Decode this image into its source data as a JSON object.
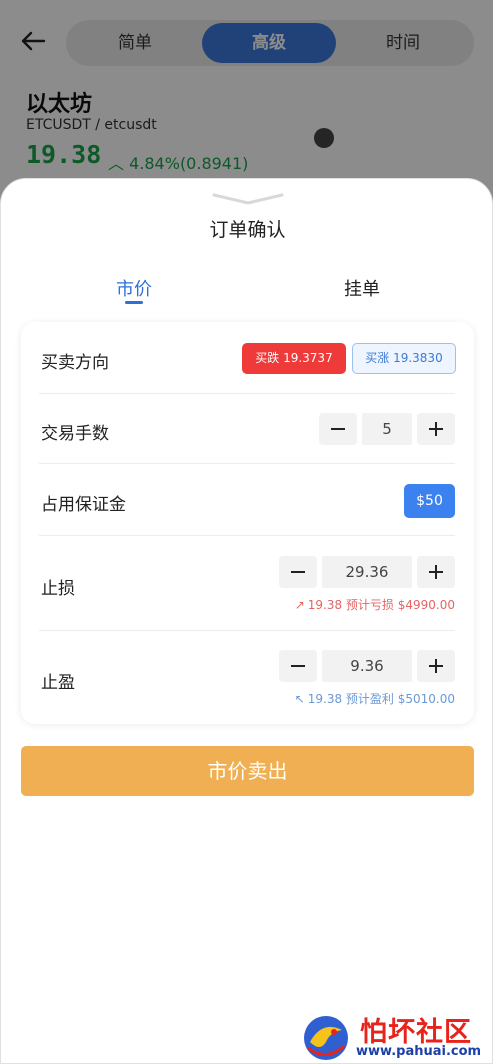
{
  "header": {
    "mode_tabs": [
      "简单",
      "高级",
      "时间"
    ],
    "active_mode": "高级"
  },
  "coin": {
    "name": "以太坊",
    "pair": "ETCUSDT / etcusdt",
    "price": "19.38",
    "change": "4.84%(0.8941)"
  },
  "sheet": {
    "title": "订单确认",
    "tabs": [
      "市价",
      "挂单"
    ],
    "active_tab": "市价",
    "direction": {
      "label": "买卖方向",
      "sell": "买跌 19.3737",
      "buy": "买涨 19.3830"
    },
    "lots": {
      "label": "交易手数",
      "value": "5"
    },
    "margin": {
      "label": "占用保证金",
      "value": "$50"
    },
    "stop_loss": {
      "label": "止损",
      "value": "29.36",
      "hint": "19.38 预计亏损 $4990.00"
    },
    "take_profit": {
      "label": "止盈",
      "value": "9.36",
      "hint": "19.38 预计盈利 $5010.00"
    },
    "submit": "市价卖出"
  },
  "watermark": {
    "title": "怕坏社区",
    "url": "www.pahuai.com"
  },
  "colors": {
    "accent": "#3b78dc",
    "sell": "#ef3a3a",
    "submit": "#f0af52",
    "up": "#1aa34a"
  }
}
